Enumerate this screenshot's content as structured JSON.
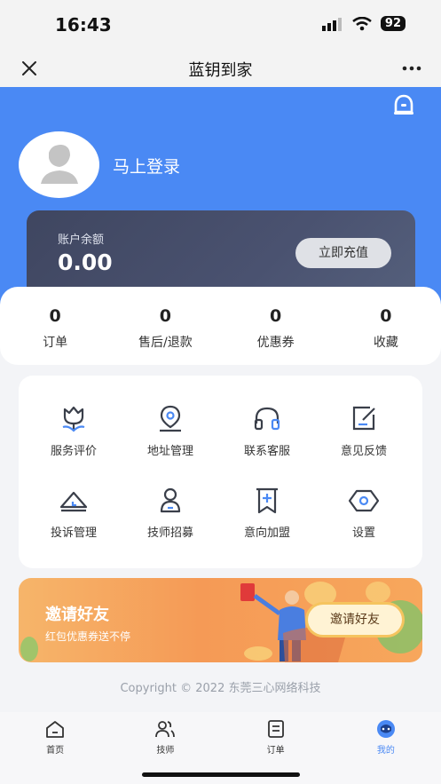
{
  "status_bar": {
    "time": "16:43",
    "battery": "92"
  },
  "nav": {
    "title": "蓝钥到家"
  },
  "profile": {
    "login_text": "马上登录"
  },
  "balance": {
    "label": "账户余额",
    "value": "0.00",
    "recharge_label": "立即充值"
  },
  "stats": [
    {
      "count": "0",
      "label": "订单"
    },
    {
      "count": "0",
      "label": "售后/退款"
    },
    {
      "count": "0",
      "label": "优惠券"
    },
    {
      "count": "0",
      "label": "收藏"
    }
  ],
  "services": [
    {
      "label": "服务评价",
      "icon": "flower-icon"
    },
    {
      "label": "地址管理",
      "icon": "location-pin-icon"
    },
    {
      "label": "联系客服",
      "icon": "headset-icon"
    },
    {
      "label": "意见反馈",
      "icon": "edit-icon"
    },
    {
      "label": "投诉管理",
      "icon": "eraser-icon"
    },
    {
      "label": "技师招募",
      "icon": "person-icon"
    },
    {
      "label": "意向加盟",
      "icon": "bookmark-plus-icon"
    },
    {
      "label": "设置",
      "icon": "settings-icon"
    }
  ],
  "invite": {
    "title": "邀请好友",
    "subtitle": "红包优惠券送不停",
    "button_label": "邀请好友"
  },
  "copyright": "Copyright © 2022 东莞三心网络科技",
  "tabbar": [
    {
      "label": "首页",
      "icon": "home-icon"
    },
    {
      "label": "技师",
      "icon": "users-icon"
    },
    {
      "label": "订单",
      "icon": "order-icon"
    },
    {
      "label": "我的",
      "icon": "mine-icon"
    }
  ],
  "colors": {
    "primary": "#4a89f4",
    "card_dark": "#454c68",
    "invite_orange": "#f59a56"
  }
}
